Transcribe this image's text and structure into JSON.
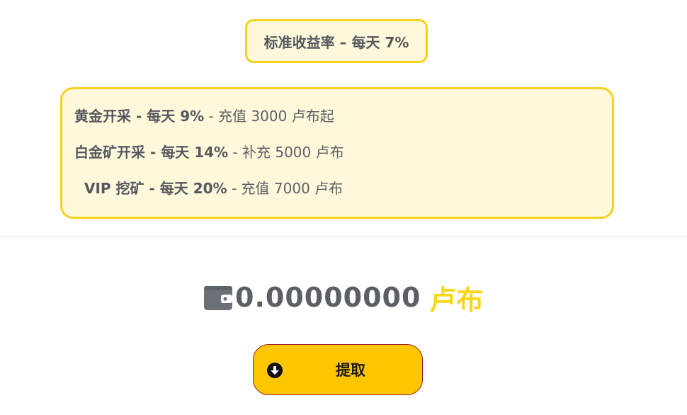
{
  "standard_rate": {
    "label": "标准收益率 – 每天 7%"
  },
  "tiers": [
    {
      "title": "黄金开采 - 每天 9%",
      "detail": " - 充值 3000 卢布起"
    },
    {
      "title": "白金矿开采 - 每天 14%",
      "detail": " - 补充 5000 卢布"
    },
    {
      "title": "VIP 挖矿 - 每天 20%",
      "detail": " - 充值 7000 卢布"
    }
  ],
  "balance": {
    "value": "0.00000000",
    "currency": "卢布",
    "icon": "wallet-icon"
  },
  "withdraw": {
    "label": "提取",
    "icon": "arrow-down-circle-icon"
  },
  "colors": {
    "accent_yellow": "#f7d21c",
    "box_background": "#fff8db",
    "button_background": "#fdc600",
    "button_border": "#9a1c1c",
    "text_gray": "#55595f"
  }
}
